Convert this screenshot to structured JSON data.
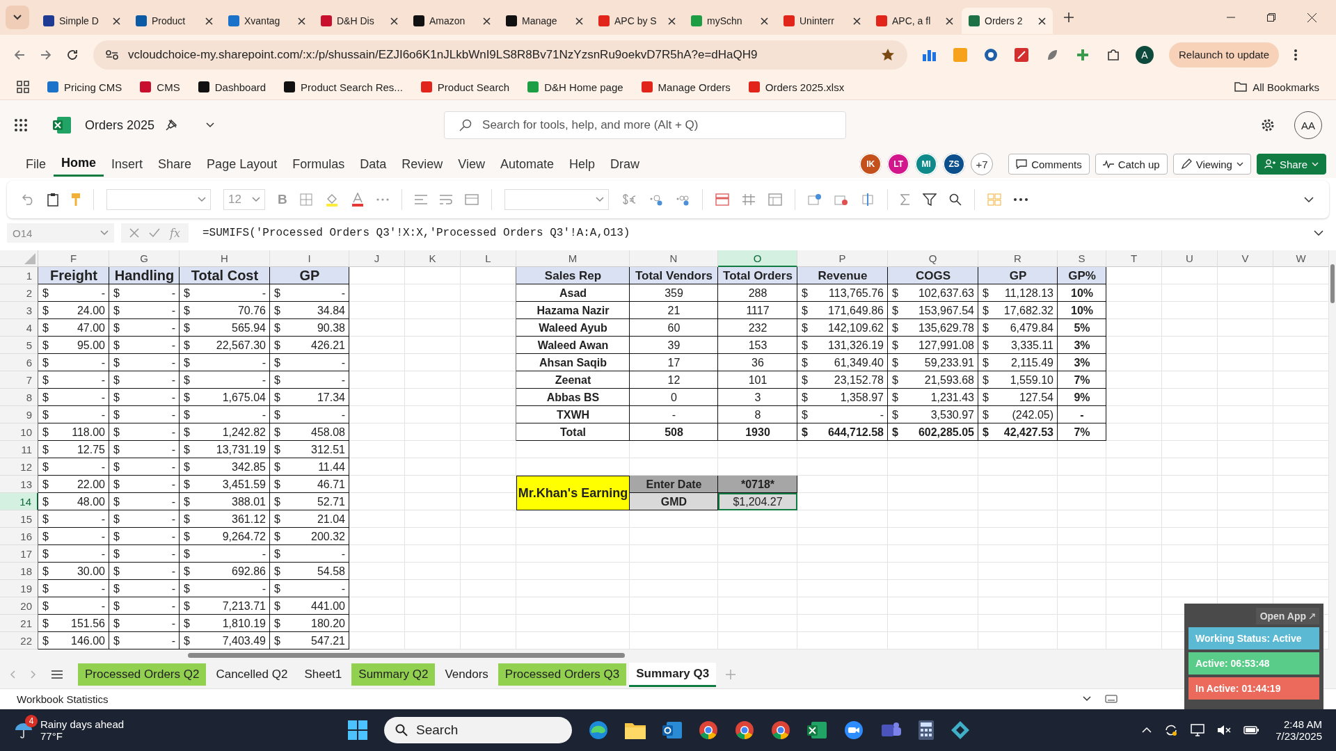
{
  "browser": {
    "tabs": [
      {
        "title": "Simple D",
        "selected": false
      },
      {
        "title": "Product",
        "selected": false
      },
      {
        "title": "Xvantag",
        "selected": false
      },
      {
        "title": "D&H Dis",
        "selected": false
      },
      {
        "title": "Amazon",
        "selected": false
      },
      {
        "title": "Manage",
        "selected": false
      },
      {
        "title": "APC by S",
        "selected": false
      },
      {
        "title": "mySchn",
        "selected": false
      },
      {
        "title": "Uninterr",
        "selected": false
      },
      {
        "title": "APC, a fl",
        "selected": false
      },
      {
        "title": "Orders 2",
        "selected": true
      }
    ],
    "address": "vcloudchoice-my.sharepoint.com/:x:/p/shussain/EZJI6o6K1nJLkbWnI9LS8R8Bv71NzYzsnRu9oekvD7R5hA?e=dHaQH9",
    "avatar": "A",
    "relaunch": "Relaunch to update",
    "bookmarks": [
      "Pricing CMS",
      "CMS",
      "Dashboard",
      "Product Search Res...",
      "Product Search",
      "D&H Home page",
      "Manage Orders",
      "Orders 2025.xlsx"
    ],
    "all_bookmarks": "All Bookmarks"
  },
  "excel": {
    "title": "Orders 2025",
    "search_placeholder": "Search for tools, help, and more (Alt + Q)",
    "avatar": "AA",
    "menu": [
      {
        "label": "File",
        "selected": false
      },
      {
        "label": "Home",
        "selected": true
      },
      {
        "label": "Insert",
        "selected": false
      },
      {
        "label": "Share",
        "selected": false
      },
      {
        "label": "Page Layout",
        "selected": false
      },
      {
        "label": "Formulas",
        "selected": false
      },
      {
        "label": "Data",
        "selected": false
      },
      {
        "label": "Review",
        "selected": false
      },
      {
        "label": "View",
        "selected": false
      },
      {
        "label": "Automate",
        "selected": false
      },
      {
        "label": "Help",
        "selected": false
      },
      {
        "label": "Draw",
        "selected": false
      }
    ],
    "collaborators": [
      {
        "initials": "IK",
        "kind": "person",
        "color": "#c4501c"
      },
      {
        "initials": "LT",
        "kind": "person",
        "color": "#d3168c"
      },
      {
        "initials": "MI",
        "kind": "person",
        "color": "#0e8a8a"
      },
      {
        "initials": "ZS",
        "kind": "person",
        "color": "#0b4f8c"
      },
      {
        "initials": "+7",
        "kind": "more"
      }
    ],
    "comments": "Comments",
    "catch_up": "Catch up",
    "viewing": "Viewing",
    "share": "Share",
    "font_size": "12",
    "bold": "B",
    "name_box": "O14",
    "fx": "fx",
    "formula": "=SUMIFS('Processed Orders Q3'!X:X,'Processed Orders Q3'!A:A,O13)"
  },
  "sheet": {
    "columns": [
      {
        "letter": "F",
        "selected": false
      },
      {
        "letter": "G",
        "selected": false
      },
      {
        "letter": "H",
        "selected": false
      },
      {
        "letter": "I",
        "selected": false
      },
      {
        "letter": "J",
        "selected": false
      },
      {
        "letter": "K",
        "selected": false
      },
      {
        "letter": "L",
        "selected": false
      },
      {
        "letter": "M",
        "selected": false
      },
      {
        "letter": "N",
        "selected": false
      },
      {
        "letter": "O",
        "selected": true
      },
      {
        "letter": "P",
        "selected": false
      },
      {
        "letter": "Q",
        "selected": false
      },
      {
        "letter": "R",
        "selected": false
      },
      {
        "letter": "S",
        "selected": false
      },
      {
        "letter": "T",
        "selected": false
      },
      {
        "letter": "U",
        "selected": false
      },
      {
        "letter": "V",
        "selected": false
      },
      {
        "letter": "W",
        "selected": false
      }
    ],
    "rows": [
      {
        "number": "1",
        "selected": false
      },
      {
        "number": "2",
        "selected": false
      },
      {
        "number": "3",
        "selected": false
      },
      {
        "number": "4",
        "selected": false
      },
      {
        "number": "5",
        "selected": false
      },
      {
        "number": "6",
        "selected": false
      },
      {
        "number": "7",
        "selected": false
      },
      {
        "number": "8",
        "selected": false
      },
      {
        "number": "9",
        "selected": false
      },
      {
        "number": "10",
        "selected": false
      },
      {
        "number": "11",
        "selected": false
      },
      {
        "number": "12",
        "selected": false
      },
      {
        "number": "13",
        "selected": false
      },
      {
        "number": "14",
        "selected": true
      },
      {
        "number": "15",
        "selected": false
      },
      {
        "number": "16",
        "selected": false
      },
      {
        "number": "17",
        "selected": false
      },
      {
        "number": "18",
        "selected": false
      },
      {
        "number": "19",
        "selected": false
      },
      {
        "number": "20",
        "selected": false
      },
      {
        "number": "21",
        "selected": false
      },
      {
        "number": "22",
        "selected": false
      }
    ],
    "cost_table": {
      "headers": [
        "Freight",
        "Handling",
        "Total Cost",
        "GP"
      ],
      "rows": [
        [
          [
            "$",
            "-"
          ],
          [
            "$",
            "-"
          ],
          [
            "$",
            "-"
          ],
          [
            "$",
            "-"
          ]
        ],
        [
          [
            "$",
            "24.00"
          ],
          [
            "$",
            "-"
          ],
          [
            "$",
            "70.76"
          ],
          [
            "$",
            "34.84"
          ]
        ],
        [
          [
            "$",
            "47.00"
          ],
          [
            "$",
            "-"
          ],
          [
            "$",
            "565.94"
          ],
          [
            "$",
            "90.38"
          ]
        ],
        [
          [
            "$",
            "95.00"
          ],
          [
            "$",
            "-"
          ],
          [
            "$",
            "22,567.30"
          ],
          [
            "$",
            "426.21"
          ]
        ],
        [
          [
            "$",
            "-"
          ],
          [
            "$",
            "-"
          ],
          [
            "$",
            "-"
          ],
          [
            "$",
            "-"
          ]
        ],
        [
          [
            "$",
            "-"
          ],
          [
            "$",
            "-"
          ],
          [
            "$",
            "-"
          ],
          [
            "$",
            "-"
          ]
        ],
        [
          [
            "$",
            "-"
          ],
          [
            "$",
            "-"
          ],
          [
            "$",
            "1,675.04"
          ],
          [
            "$",
            "17.34"
          ]
        ],
        [
          [
            "$",
            "-"
          ],
          [
            "$",
            "-"
          ],
          [
            "$",
            "-"
          ],
          [
            "$",
            "-"
          ]
        ],
        [
          [
            "$",
            "118.00"
          ],
          [
            "$",
            "-"
          ],
          [
            "$",
            "1,242.82"
          ],
          [
            "$",
            "458.08"
          ]
        ],
        [
          [
            "$",
            "12.75"
          ],
          [
            "$",
            "-"
          ],
          [
            "$",
            "13,731.19"
          ],
          [
            "$",
            "312.51"
          ]
        ],
        [
          [
            "$",
            "-"
          ],
          [
            "$",
            "-"
          ],
          [
            "$",
            "342.85"
          ],
          [
            "$",
            "11.44"
          ]
        ],
        [
          [
            "$",
            "22.00"
          ],
          [
            "$",
            "-"
          ],
          [
            "$",
            "3,451.59"
          ],
          [
            "$",
            "46.71"
          ]
        ],
        [
          [
            "$",
            "48.00"
          ],
          [
            "$",
            "-"
          ],
          [
            "$",
            "388.01"
          ],
          [
            "$",
            "52.71"
          ]
        ],
        [
          [
            "$",
            "-"
          ],
          [
            "$",
            "-"
          ],
          [
            "$",
            "361.12"
          ],
          [
            "$",
            "21.04"
          ]
        ],
        [
          [
            "$",
            "-"
          ],
          [
            "$",
            "-"
          ],
          [
            "$",
            "9,264.72"
          ],
          [
            "$",
            "200.32"
          ]
        ],
        [
          [
            "$",
            "-"
          ],
          [
            "$",
            "-"
          ],
          [
            "$",
            "-"
          ],
          [
            "$",
            "-"
          ]
        ],
        [
          [
            "$",
            "30.00"
          ],
          [
            "$",
            "-"
          ],
          [
            "$",
            "692.86"
          ],
          [
            "$",
            "54.58"
          ]
        ],
        [
          [
            "$",
            "-"
          ],
          [
            "$",
            "-"
          ],
          [
            "$",
            "-"
          ],
          [
            "$",
            "-"
          ]
        ],
        [
          [
            "$",
            "-"
          ],
          [
            "$",
            "-"
          ],
          [
            "$",
            "7,213.71"
          ],
          [
            "$",
            "441.00"
          ]
        ],
        [
          [
            "$",
            "151.56"
          ],
          [
            "$",
            "-"
          ],
          [
            "$",
            "1,810.19"
          ],
          [
            "$",
            "180.20"
          ]
        ],
        [
          [
            "$",
            "146.00"
          ],
          [
            "$",
            "-"
          ],
          [
            "$",
            "7,403.49"
          ],
          [
            "$",
            "547.21"
          ]
        ]
      ]
    },
    "sales_table": {
      "headers": [
        "Sales Rep",
        "Total Vendors",
        "Total Orders",
        "Revenue",
        "COGS",
        "GP",
        "GP%"
      ],
      "rows": [
        {
          "kind": "rep",
          "name": "Asad",
          "vendors": "359",
          "orders": "288",
          "revenue": [
            "$",
            "113,765.76"
          ],
          "cogs": [
            "$",
            "102,637.63"
          ],
          "gp": [
            "$",
            "11,128.13"
          ],
          "gp_pct": "10%"
        },
        {
          "kind": "rep",
          "name": "Hazama Nazir",
          "vendors": "21",
          "orders": "1117",
          "revenue": [
            "$",
            "171,649.86"
          ],
          "cogs": [
            "$",
            "153,967.54"
          ],
          "gp": [
            "$",
            "17,682.32"
          ],
          "gp_pct": "10%"
        },
        {
          "kind": "rep",
          "name": "Waleed Ayub",
          "vendors": "60",
          "orders": "232",
          "revenue": [
            "$",
            "142,109.62"
          ],
          "cogs": [
            "$",
            "135,629.78"
          ],
          "gp": [
            "$",
            "6,479.84"
          ],
          "gp_pct": "5%"
        },
        {
          "kind": "rep",
          "name": "Waleed Awan",
          "vendors": "39",
          "orders": "153",
          "revenue": [
            "$",
            "131,326.19"
          ],
          "cogs": [
            "$",
            "127,991.08"
          ],
          "gp": [
            "$",
            "3,335.11"
          ],
          "gp_pct": "3%"
        },
        {
          "kind": "rep",
          "name": "Ahsan Saqib",
          "vendors": "17",
          "orders": "36",
          "revenue": [
            "$",
            "61,349.40"
          ],
          "cogs": [
            "$",
            "59,233.91"
          ],
          "gp": [
            "$",
            "2,115.49"
          ],
          "gp_pct": "3%"
        },
        {
          "kind": "rep",
          "name": "Zeenat",
          "vendors": "12",
          "orders": "101",
          "revenue": [
            "$",
            "23,152.78"
          ],
          "cogs": [
            "$",
            "21,593.68"
          ],
          "gp": [
            "$",
            "1,559.10"
          ],
          "gp_pct": "7%"
        },
        {
          "kind": "rep",
          "name": "Abbas BS",
          "vendors": "0",
          "orders": "3",
          "revenue": [
            "$",
            "1,358.97"
          ],
          "cogs": [
            "$",
            "1,231.43"
          ],
          "gp": [
            "$",
            "127.54"
          ],
          "gp_pct": "9%"
        },
        {
          "kind": "rep",
          "name": "TXWH",
          "vendors": "-",
          "orders": "8",
          "revenue": [
            "$",
            "-"
          ],
          "cogs": [
            "$",
            "3,530.97"
          ],
          "gp": [
            "$",
            "(242.05)"
          ],
          "gp_pct": "-"
        },
        {
          "kind": "total",
          "name": "Total",
          "vendors": "508",
          "orders": "1930",
          "revenue": [
            "$",
            "644,712.58"
          ],
          "cogs": [
            "$",
            "602,285.05"
          ],
          "gp": [
            "$",
            "42,427.53"
          ],
          "gp_pct": "7%"
        }
      ]
    },
    "earnings": {
      "title": "Mr.Khan's Earning",
      "date_label": "Enter Date",
      "date_value": "*0718*",
      "amount_label": "GMD",
      "amount_value": "$1,204.27"
    },
    "sheet_tabs": [
      {
        "label": "Processed Orders Q2",
        "selected": false,
        "color": "#92d050"
      },
      {
        "label": "Cancelled Q2",
        "selected": false
      },
      {
        "label": "Sheet1",
        "selected": false
      },
      {
        "label": "Summary Q2",
        "selected": false,
        "color": "#92d050"
      },
      {
        "label": "Vendors",
        "selected": false
      },
      {
        "label": "Processed Orders Q3",
        "selected": false,
        "color": "#92d050"
      },
      {
        "label": "Summary Q3",
        "selected": true
      }
    ],
    "status": "Workbook Statistics"
  },
  "tracker": {
    "open_app": "Open App",
    "status": "Working Status: Active",
    "active": "Active: 06:53:48",
    "inactive": "In Active: 01:44:19"
  },
  "taskbar": {
    "weather_badge": "4",
    "weather_title": "Rainy days ahead",
    "temperature": "77°F",
    "search": "Search",
    "time": "2:48 AM",
    "date": "7/23/2025"
  }
}
